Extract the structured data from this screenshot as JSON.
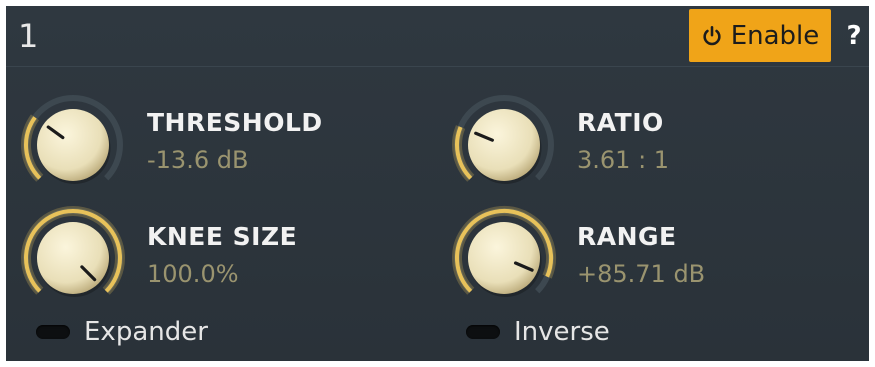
{
  "header": {
    "title": "1",
    "enable_label": "Enable",
    "help_label": "?"
  },
  "params": [
    {
      "key": "threshold",
      "name": "THRESHOLD",
      "value": "-13.6 dB",
      "position": 0.3
    },
    {
      "key": "ratio",
      "name": "RATIO",
      "value": "3.61 : 1",
      "position": 0.25
    },
    {
      "key": "knee",
      "name": "KNEE SIZE",
      "value": "100.0%",
      "position": 1.0
    },
    {
      "key": "range",
      "name": "RANGE",
      "value": "+85.71 dB",
      "position": 0.92
    }
  ],
  "toggles": [
    {
      "key": "expander",
      "label": "Expander",
      "on": false
    },
    {
      "key": "inverse",
      "label": "Inverse",
      "on": false
    }
  ],
  "colors": {
    "accent": "#f0a418",
    "value_text": "#9a946f",
    "arc_active": "#e8c25a",
    "arc_track": "#3d4850",
    "knob_face": "#e9dfb8"
  }
}
